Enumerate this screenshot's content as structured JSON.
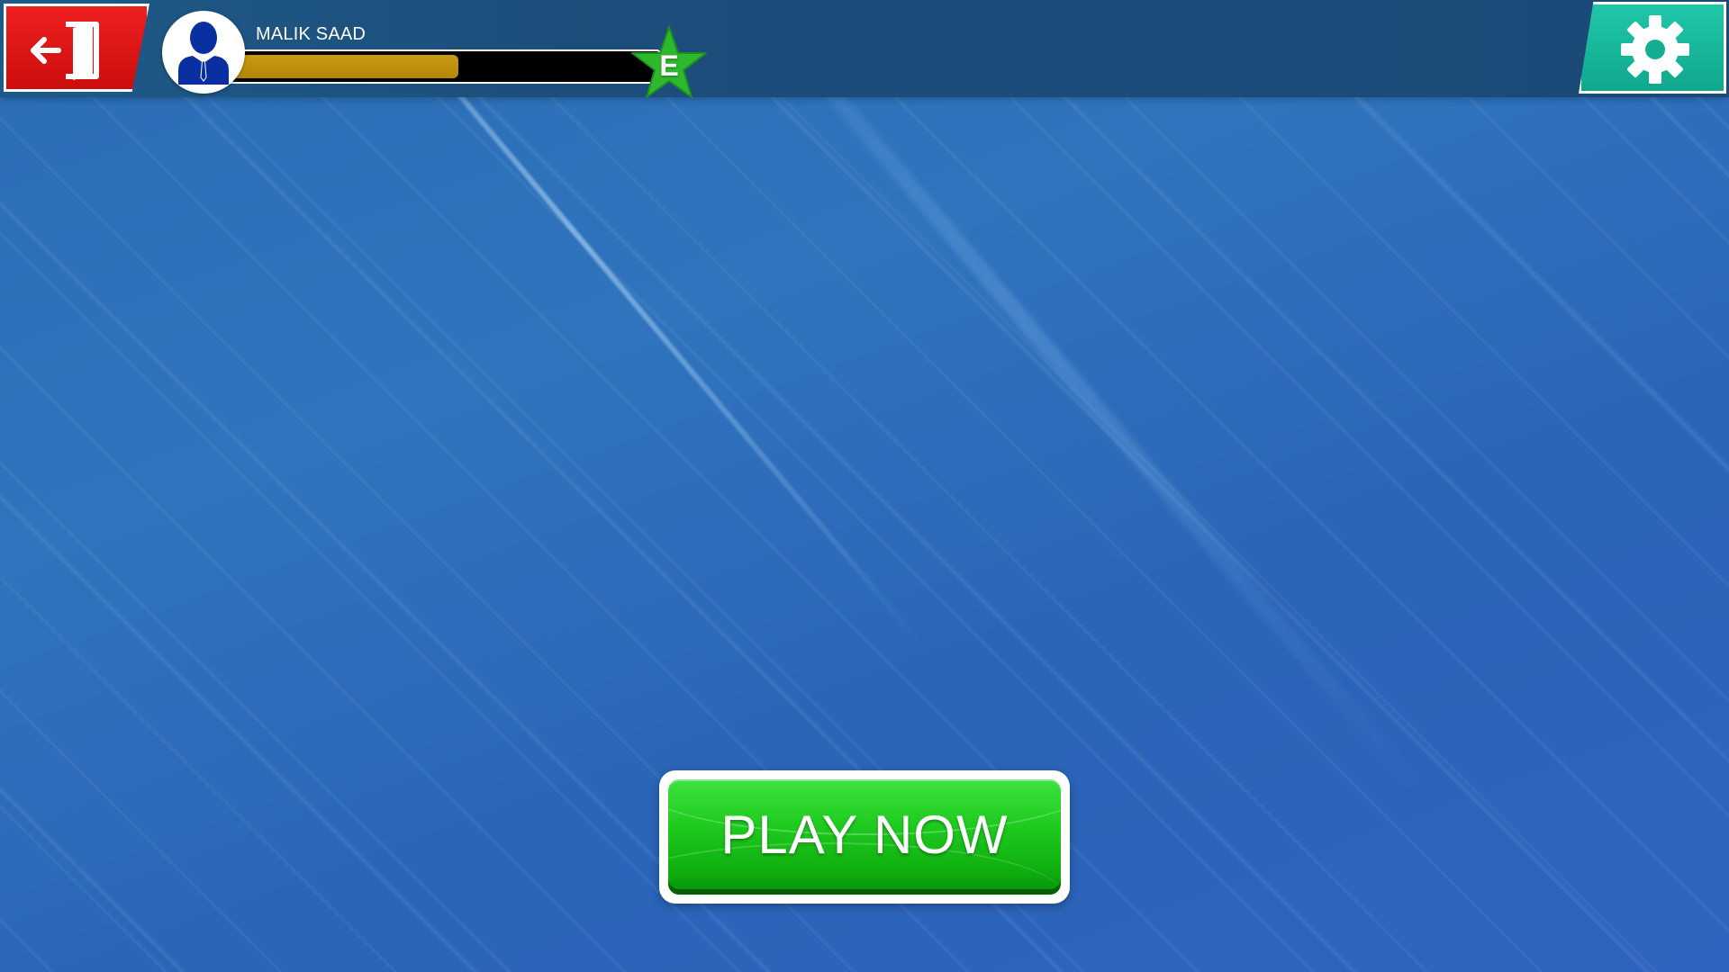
{
  "player": {
    "name": "MALIK SAAD",
    "avatar_icon": "businessman-icon",
    "xp_progress": 0.53,
    "level_badge": "E",
    "level_badge_color": "#2db82d"
  },
  "buttons": {
    "exit_icon": "exit-door-icon",
    "exit_color": "#dd1515",
    "settings_icon": "gear-icon",
    "settings_color": "#18b89a",
    "play_label": "PLAY NOW",
    "play_color": "#1fcb1f"
  },
  "theme": {
    "background": "#2a6db5",
    "topbar": "#1d4d7a",
    "xp_fill": "#b8900c"
  }
}
